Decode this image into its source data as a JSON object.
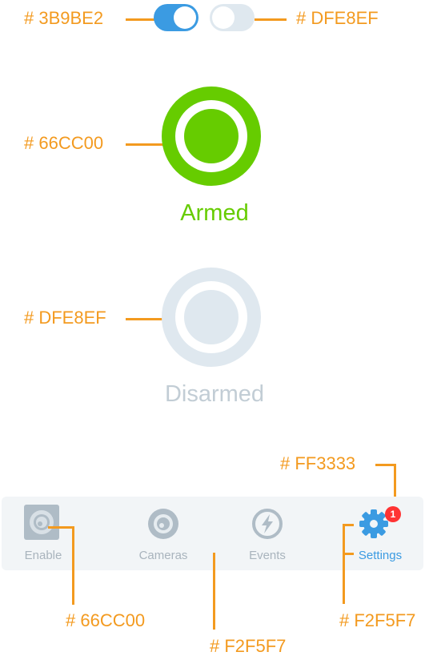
{
  "colors": {
    "toggle_on": "#3B9BE2",
    "toggle_off": "#DFE8EF",
    "armed": "#66CC00",
    "disarmed": "#DFE8EF",
    "badge": "#FF3333",
    "tabbar_bg": "#F2F5F7",
    "annotation": "#F39A1F"
  },
  "annotations": {
    "toggle_on": "# 3B9BE2",
    "toggle_off": "# DFE8EF",
    "armed": "# 66CC00",
    "disarmed": "# DFE8EF",
    "badge": "# FF3333",
    "enable_tab": "# 66CC00",
    "tabbar_bg": "# F2F5F7",
    "settings_tab": "# F2F5F7"
  },
  "states": {
    "armed_label": "Armed",
    "disarmed_label": "Disarmed"
  },
  "toggles": {
    "on": true,
    "off": false
  },
  "tabs": [
    {
      "label": "Enable",
      "icon": "enable-icon"
    },
    {
      "label": "Cameras",
      "icon": "camera-icon"
    },
    {
      "label": "Events",
      "icon": "lightning-icon"
    },
    {
      "label": "Settings",
      "icon": "gear-icon",
      "badge": "1"
    }
  ]
}
